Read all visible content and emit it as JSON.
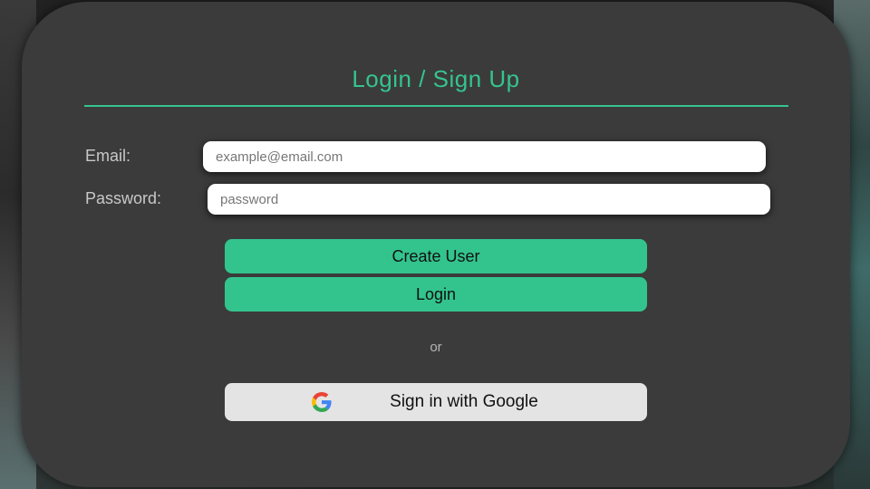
{
  "form": {
    "title": "Login / Sign Up",
    "email_label": "Email:",
    "email_placeholder": "example@email.com",
    "password_label": "Password:",
    "password_placeholder": "password"
  },
  "actions": {
    "create_user_label": "Create User",
    "login_label": "Login",
    "separator": "or",
    "google_label": "Sign in with Google",
    "google_icon": "google-logo-icon"
  },
  "colors": {
    "accent": "#35c48f",
    "card": "#3b3b3b",
    "google_button": "#e4e4e4"
  }
}
